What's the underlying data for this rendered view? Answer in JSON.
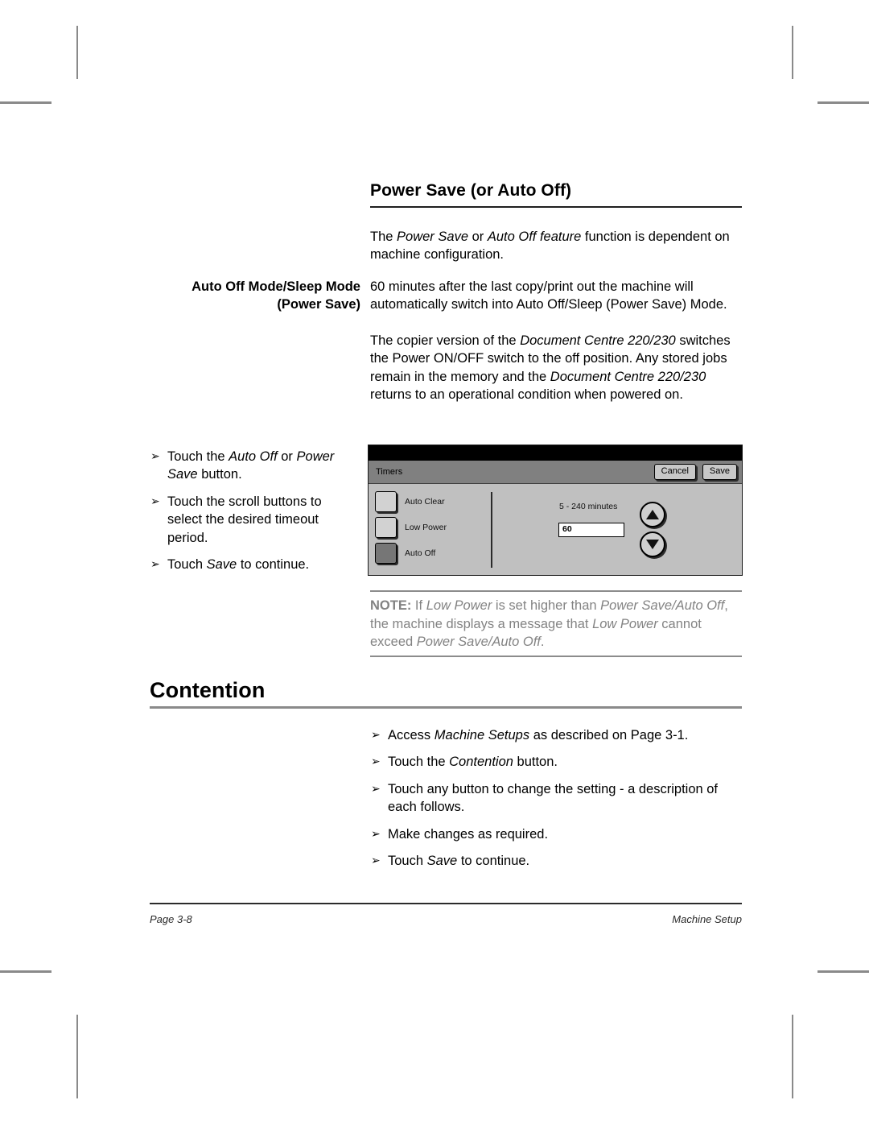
{
  "document": {
    "section1": {
      "heading": "Power Save (or Auto Off)",
      "intro": {
        "part1": "The ",
        "em1": "Power Save",
        "part2": " or ",
        "em2": "Auto Off feature",
        "part3": " function is dependent on machine configuration."
      },
      "side_label_line1": "Auto Off Mode/Sleep Mode",
      "side_label_line2": "(Power Save)",
      "para1": "60 minutes after the last copy/print out the machine will automatically switch into Auto Off/Sleep (Power Save) Mode.",
      "para2": {
        "part1": "The copier version of the ",
        "em1": "Document Centre 220/230",
        "part2": " switches the Power ON/OFF switch to the off position. Any stored jobs remain in the memory and the ",
        "em2": "Document Centre 220/230",
        "part3": " returns to an operational condition when powered on."
      },
      "steps": [
        {
          "pre": "Touch the ",
          "em1": "Auto Off",
          "mid": " or ",
          "em2": "Power Save",
          "post": " button."
        },
        {
          "pre": "Touch the scroll buttons to select the desired timeout period.",
          "em1": "",
          "mid": "",
          "em2": "",
          "post": ""
        },
        {
          "pre": "Touch ",
          "em1": "Save",
          "mid": "",
          "em2": "",
          "post": " to continue."
        }
      ],
      "note": {
        "label": "NOTE:",
        "p1": " If ",
        "em1": "Low Power",
        "p2": " is set higher than ",
        "em2": "Power Save/Auto Off",
        "p3": ", the machine displays a message that ",
        "em3": "Low Power",
        "p4": " cannot exceed ",
        "em4": "Power Save/Auto Off",
        "p5": "."
      }
    },
    "section2": {
      "heading": "Contention",
      "steps": [
        {
          "pre": "Access ",
          "em1": "Machine Setups",
          "mid": "",
          "em2": "",
          "post": " as described on Page 3-1."
        },
        {
          "pre": "Touch the ",
          "em1": "Contention",
          "mid": "",
          "em2": "",
          "post": " button."
        },
        {
          "pre": "Touch any button to change the setting - a description of each follows.",
          "em1": "",
          "mid": "",
          "em2": "",
          "post": ""
        },
        {
          "pre": "Make changes as required.",
          "em1": "",
          "mid": "",
          "em2": "",
          "post": ""
        },
        {
          "pre": "Touch ",
          "em1": "Save",
          "mid": "",
          "em2": "",
          "post": " to continue."
        }
      ]
    },
    "footer": {
      "page": "Page 3-8",
      "chapter": "Machine Setup"
    },
    "bullet_glyph": "➢"
  },
  "copier_ui": {
    "title": "Timers",
    "cancel_label": "Cancel",
    "save_label": "Save",
    "options": [
      {
        "label": "Auto Clear",
        "selected": false
      },
      {
        "label": "Low Power",
        "selected": false
      },
      {
        "label": "Auto Off",
        "selected": true
      }
    ],
    "range_label": "5 - 240 minutes",
    "value": "60",
    "colors": {
      "titlebar": "#808080",
      "body": "#c0c0c0",
      "selected_swatch": "#767676",
      "topbar": "#000000"
    }
  }
}
